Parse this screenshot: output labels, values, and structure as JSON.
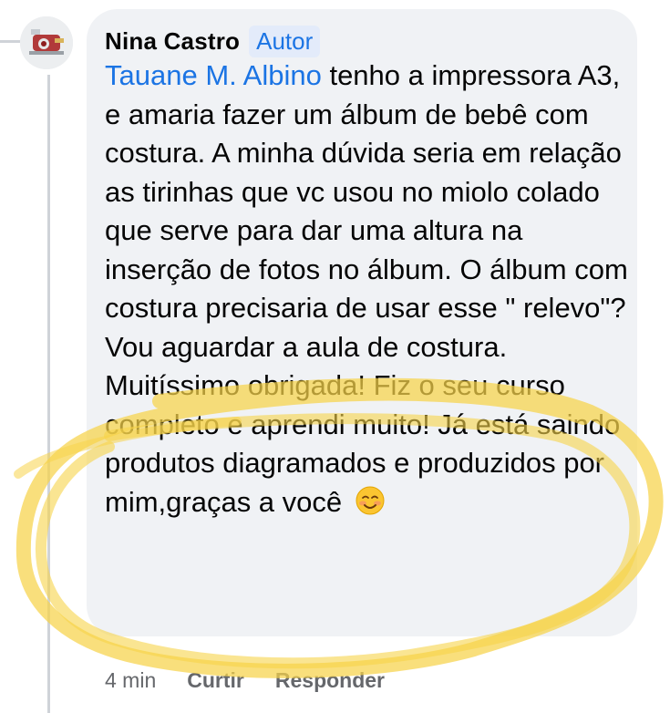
{
  "comment": {
    "author_name": "Nina Castro",
    "author_badge": "Autor",
    "mention": "Tauane M. Albino",
    "text": "tenho a impressora A3, e amaria fazer um álbum de bebê com costura. A minha dúvida seria em relação as tirinhas que vc usou no miolo colado que serve para dar uma altura na inserção de fotos no álbum. O álbum com costura precisaria de usar esse \" relevo\"? Vou aguardar a aula de costura. Muitíssimo obrigada! Fiz o seu curso completo e aprendi muito! Já está saindo produtos diagramados e produzidos por mim,graças a você",
    "emoji": "smiling-face-emoji"
  },
  "meta": {
    "time": "4 min",
    "like_label": "Curtir",
    "reply_label": "Responder"
  },
  "colors": {
    "bubble": "#f0f2f5",
    "mention": "#1b74e4",
    "badge_bg": "#e3ebfa",
    "meta_text": "#65676b",
    "highlight": "#f7d34a"
  }
}
